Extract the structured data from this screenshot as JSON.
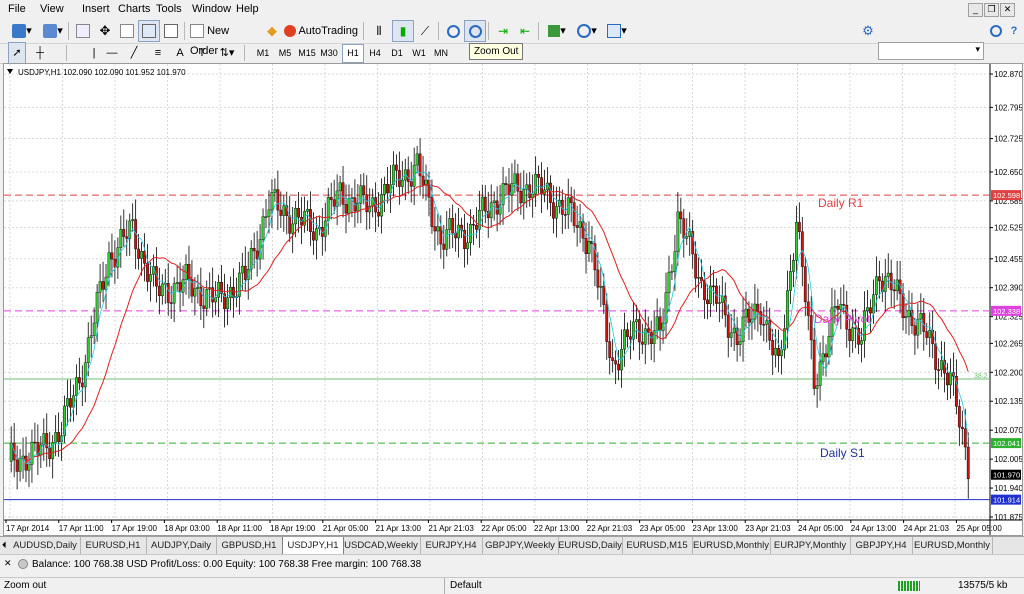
{
  "menu": [
    "File",
    "View",
    "Insert",
    "Charts",
    "Tools",
    "Window",
    "Help"
  ],
  "toolbar": {
    "new_order": "New Order",
    "auto_trading": "AutoTrading",
    "timeframes": [
      "M1",
      "M5",
      "M15",
      "M30",
      "H1",
      "H4",
      "D1",
      "W1",
      "MN"
    ],
    "active_timeframe": "H1",
    "tooltip": "Zoom Out"
  },
  "chart": {
    "header": "USDJPY,H1  102.090 102.090 101.952 101.970",
    "price_axis": [
      "102.870",
      "102.795",
      "102.725",
      "102.650",
      "102.585",
      "102.525",
      "102.455",
      "102.390",
      "102.325",
      "102.265",
      "102.200",
      "102.135",
      "102.070",
      "102.005",
      "101.940",
      "101.875"
    ],
    "time_axis": [
      "17 Apr 2014",
      "17 Apr 11:00",
      "17 Apr 19:00",
      "18 Apr 03:00",
      "18 Apr 11:00",
      "18 Apr 19:00",
      "21 Apr 05:00",
      "21 Apr 13:00",
      "21 Apr 21:03",
      "22 Apr 05:00",
      "22 Apr 13:00",
      "22 Apr 21:03",
      "23 Apr 05:00",
      "23 Apr 13:00",
      "23 Apr 21:03",
      "24 Apr 05:00",
      "24 Apr 13:00",
      "24 Apr 21:03",
      "25 Apr 05:00"
    ],
    "labels": {
      "r1": "Daily R1",
      "pivot": "Daily Pivot",
      "s1": "Daily S1",
      "fib": "38.2"
    },
    "price_tags": {
      "r1": "102.598",
      "pivot": "102.338",
      "s1": "102.041",
      "bid": "101.970",
      "support": "101.914"
    },
    "colors": {
      "bull": "#32cd32",
      "bear": "#cc1111",
      "ma": "#e02020",
      "signal": "#26c6da",
      "r1": "#e04040",
      "pivot": "#e040e0",
      "s1": "#30b030",
      "support": "#2030d0",
      "fib": "#70c070"
    }
  },
  "tabs": [
    "AUDUSD,Daily",
    "EURUSD,H1",
    "AUDJPY,Daily",
    "GBPUSD,H1",
    "USDJPY,H1",
    "USDCAD,Weekly",
    "EURJPY,H4",
    "GBPJPY,Weekly",
    "EURUSD,Daily",
    "EURUSD,M15",
    "EURUSD,Monthly",
    "EURJPY,Monthly",
    "GBPJPY,H4",
    "EURUSD,Monthly"
  ],
  "active_tab": "USDJPY,H1",
  "terminal": {
    "balance_line": "Balance: 100 768.38 USD  Profit/Loss: 0.00  Equity: 100 768.38  Free margin: 100 768.38"
  },
  "status": {
    "left": "Zoom out",
    "profile": "Default",
    "traffic": "13575/5 kb"
  }
}
